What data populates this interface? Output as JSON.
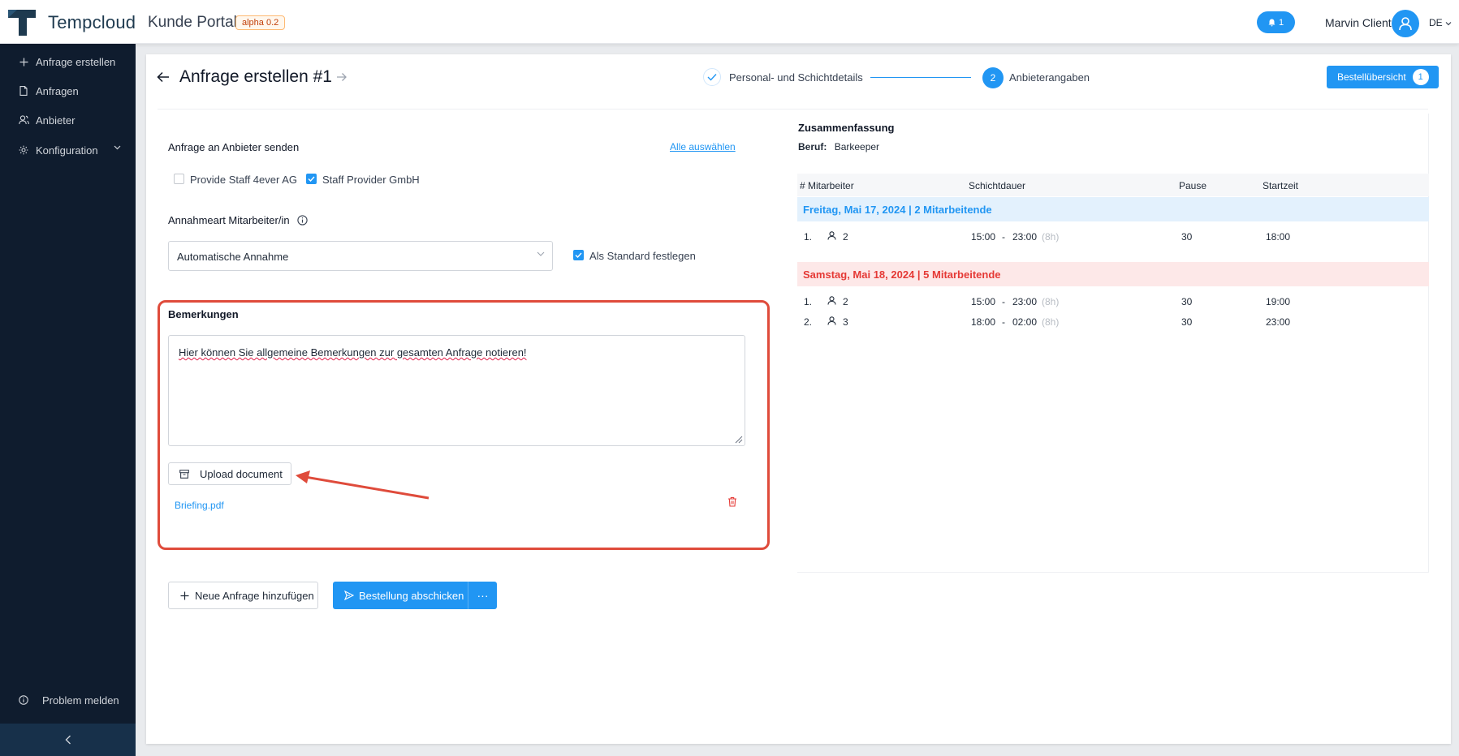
{
  "header": {
    "brand": "Tempcloud",
    "portal": "Kunde Portal",
    "version_badge": "alpha 0.2",
    "notifications": "1",
    "user_name": "Marvin Client",
    "language": "DE"
  },
  "sidebar": {
    "items": [
      {
        "label": "Anfrage erstellen",
        "icon": "plus-icon"
      },
      {
        "label": "Anfragen",
        "icon": "document-icon"
      },
      {
        "label": "Anbieter",
        "icon": "users-icon"
      },
      {
        "label": "Konfiguration",
        "icon": "gear-icon"
      }
    ],
    "report_label": "Problem melden"
  },
  "page": {
    "title": "Anfrage erstellen #1",
    "steps": [
      {
        "label": "Personal- und Schichtdetails",
        "state": "done"
      },
      {
        "number": "2",
        "label": "Anbieterangaben",
        "state": "active"
      }
    ],
    "order_overview": {
      "label": "Bestellübersicht",
      "count": "1"
    }
  },
  "form": {
    "providers_label": "Anfrage an Anbieter senden",
    "select_all": "Alle auswählen",
    "providers": [
      {
        "name": "Provide Staff 4ever AG",
        "checked": false
      },
      {
        "name": "Staff Provider GmbH",
        "checked": true
      }
    ],
    "acceptance_label": "Annahmeart Mitarbeiter/in",
    "acceptance_value": "Automatische Annahme",
    "default_label": "Als Standard festlegen",
    "default_checked": true,
    "remarks_label": "Bemerkungen",
    "remarks_text": "Hier können Sie allgemeine Bemerkungen zur gesamten Anfrage notieren!",
    "upload_label": "Upload document",
    "file_name": "Briefing.pdf",
    "add_request": "Neue Anfrage hinzufügen",
    "submit": "Bestellung abschicken",
    "more": "···"
  },
  "summary": {
    "title": "Zusammenfassung",
    "job_label": "Beruf:",
    "job_value": "Barkeeper",
    "columns": [
      "# Mitarbeiter",
      "Schichtdauer",
      "Pause",
      "Startzeit"
    ],
    "days": [
      {
        "label": "Freitag, Mai 17, 2024 | 2 Mitarbeitende",
        "color": "#2196f3",
        "rows": [
          {
            "index": "1.",
            "count": "2",
            "from": "15:00",
            "to": "23:00",
            "duration": "(8h)",
            "pause": "30",
            "start": "18:00"
          }
        ]
      },
      {
        "label": "Samstag, Mai 18, 2024 | 5 Mitarbeitende",
        "color": "#e53935",
        "rows": [
          {
            "index": "1.",
            "count": "2",
            "from": "15:00",
            "to": "23:00",
            "duration": "(8h)",
            "pause": "30",
            "start": "19:00"
          },
          {
            "index": "2.",
            "count": "3",
            "from": "18:00",
            "to": "02:00",
            "duration": "(8h)",
            "pause": "30",
            "start": "23:00"
          }
        ]
      }
    ]
  },
  "colors": {
    "accent": "#2196f3",
    "sidebar_bg": "#0f1c2e",
    "annotation": "#df4b3b"
  }
}
